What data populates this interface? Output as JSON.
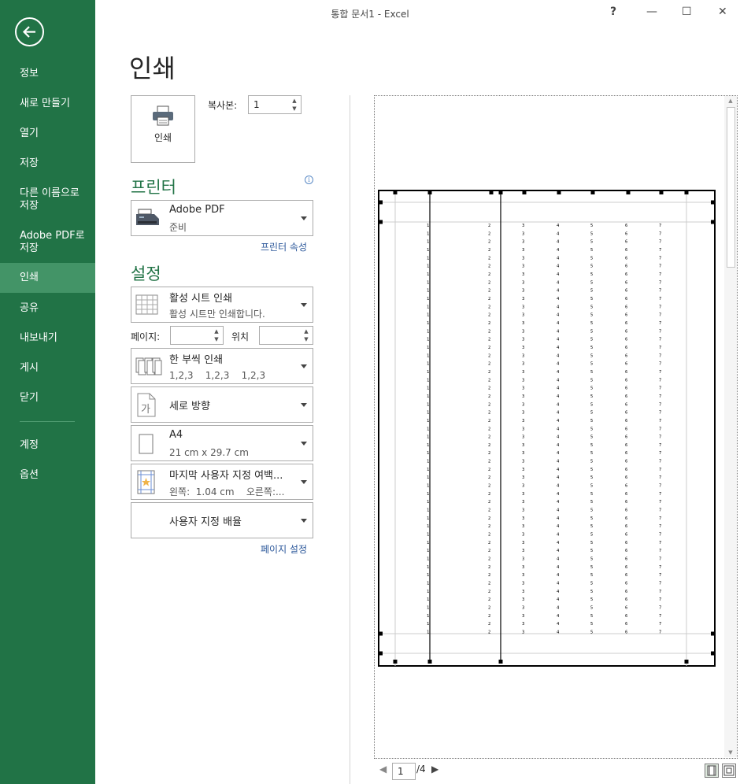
{
  "window": {
    "title": "통합 문서1 - Excel",
    "help": "?",
    "minimize": "—",
    "maximize": "☐",
    "close": "✕"
  },
  "sidebar": {
    "items": [
      {
        "label": "정보"
      },
      {
        "label": "새로 만들기"
      },
      {
        "label": "열기"
      },
      {
        "label": "저장"
      },
      {
        "label": "다른 이름으로\n저장"
      },
      {
        "label": "Adobe PDF로\n저장"
      },
      {
        "label": "인쇄"
      },
      {
        "label": "공유"
      },
      {
        "label": "내보내기"
      },
      {
        "label": "게시"
      },
      {
        "label": "닫기"
      },
      {
        "label": "계정"
      },
      {
        "label": "옵션"
      }
    ],
    "active": "인쇄"
  },
  "main": {
    "title": "인쇄",
    "print_button": "인쇄",
    "copies_label": "복사본:",
    "copies_value": "1",
    "printer_heading": "프린터",
    "printer": {
      "name": "Adobe PDF",
      "status": "준비"
    },
    "printer_props_link": "프린터 속성",
    "settings_heading": "설정",
    "settings": {
      "what": {
        "main": "활성 시트 인쇄",
        "sub": "활성 시트만 인쇄합니다."
      },
      "pages_label": "페이지:",
      "pages_from": "",
      "to_label": "위치",
      "pages_to": "",
      "collate": {
        "main": "한 부씩 인쇄",
        "sub": "1,2,3    1,2,3    1,2,3"
      },
      "orientation": {
        "main": "세로 방향"
      },
      "paper": {
        "main": "A4",
        "sub": "21 cm x 29.7 cm"
      },
      "margins": {
        "main": "마지막 사용자 지정 여백...",
        "sub": "왼쪽:  1.04 cm    오른쪽:..."
      },
      "scaling": {
        "main": "사용자 지정 배율"
      }
    },
    "page_setup_link": "페이지 설정"
  },
  "preview": {
    "current_page": "1",
    "total_pages": "/4",
    "column_digits": [
      "1",
      "2",
      "3",
      "4",
      "5",
      "6",
      "7"
    ]
  }
}
